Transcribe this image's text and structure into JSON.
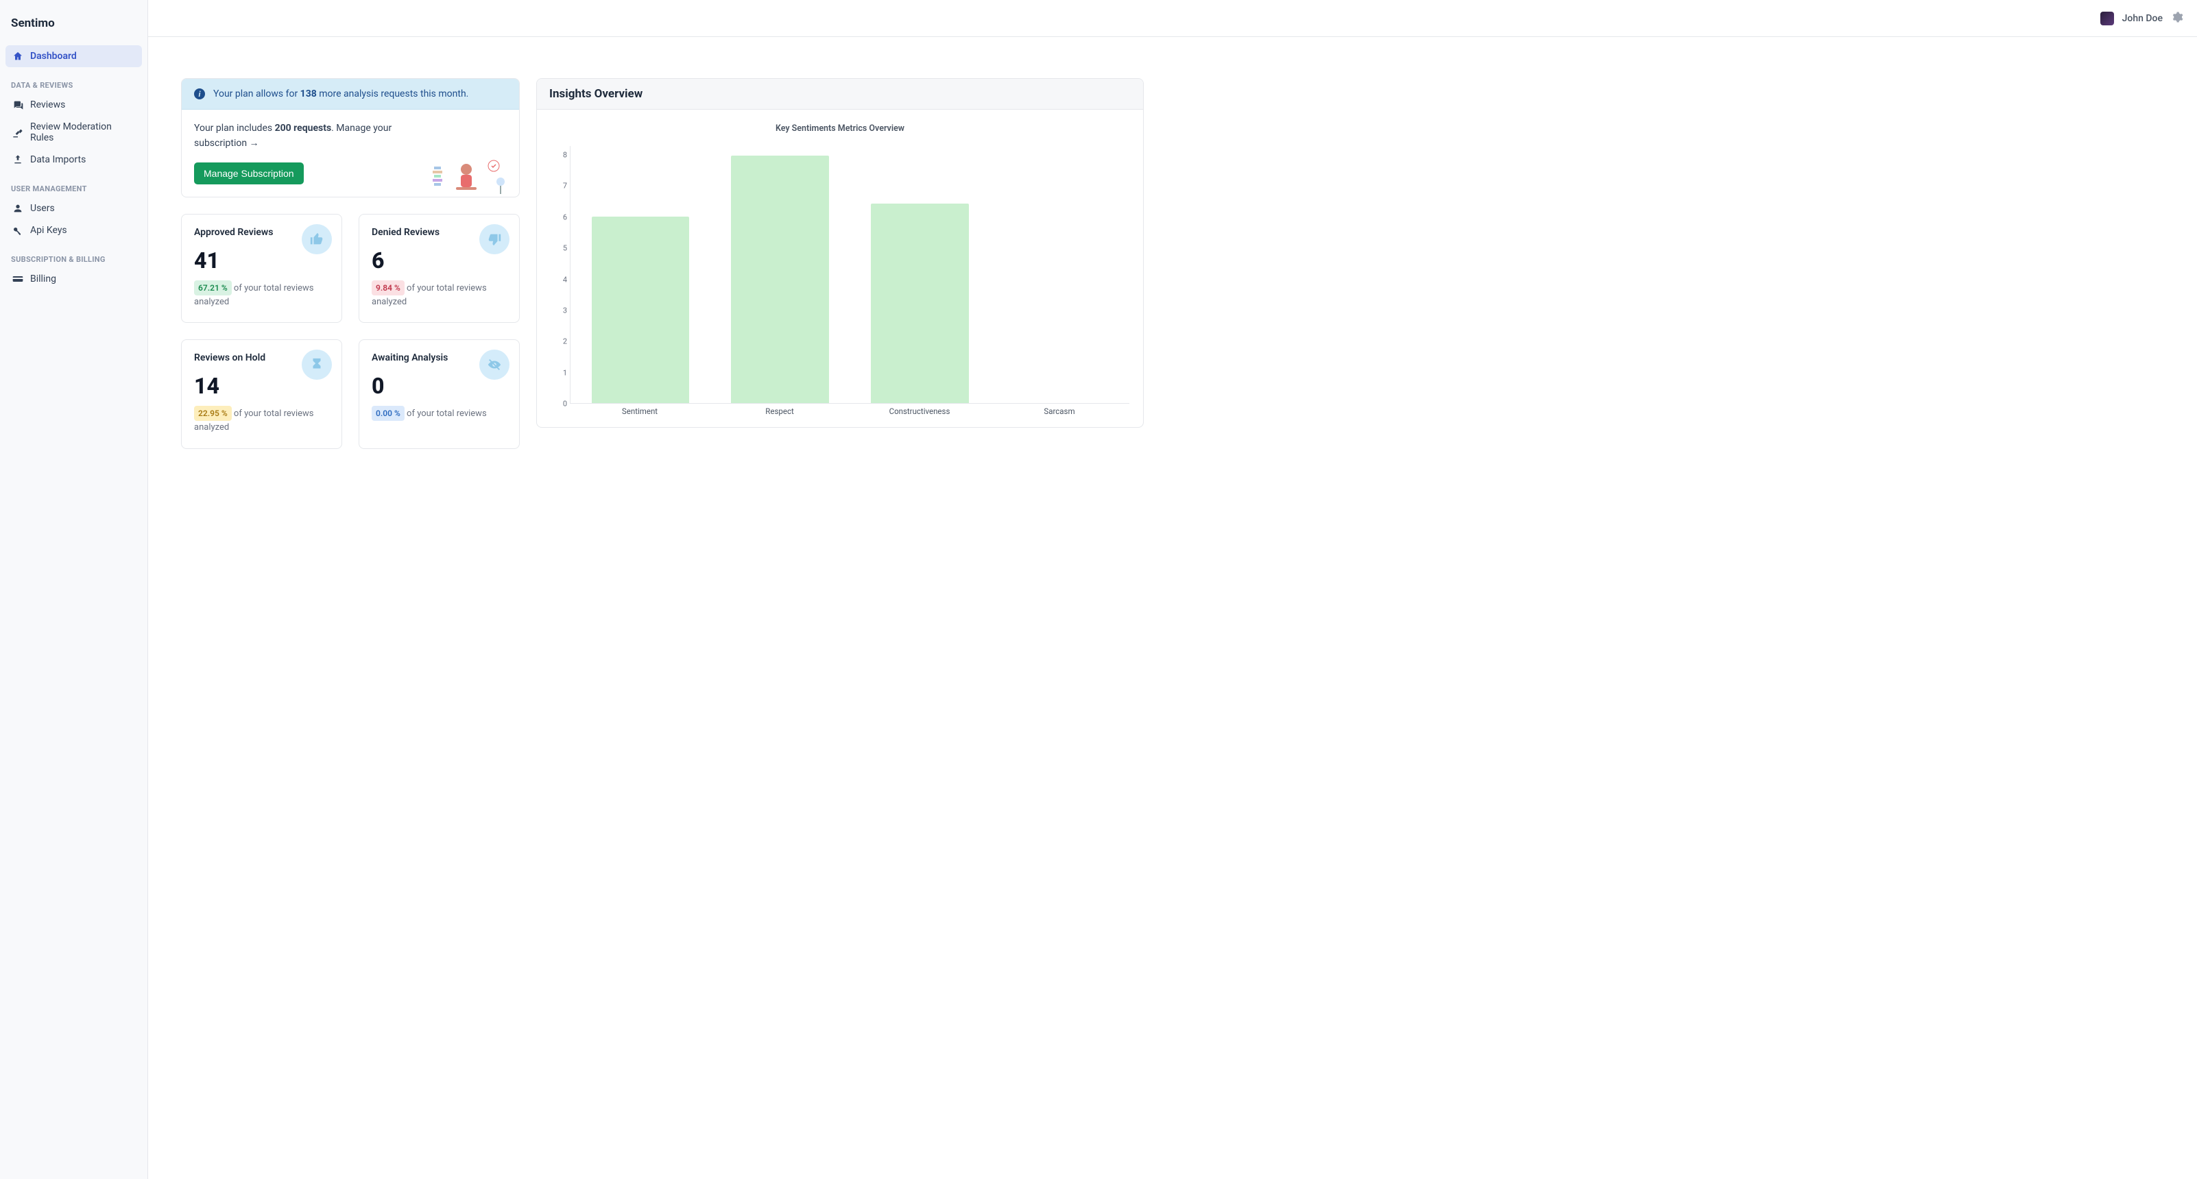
{
  "brand": "Sentimo",
  "user": {
    "name": "John Doe"
  },
  "sidebar": {
    "items": {
      "dashboard": "Dashboard",
      "reviews": "Reviews",
      "moderation": "Review Moderation Rules",
      "imports": "Data Imports",
      "users": "Users",
      "apikeys": "Api Keys",
      "billing": "Billing"
    },
    "headings": {
      "data": "DATA & REVIEWS",
      "usermgmt": "USER MANAGEMENT",
      "sub": "SUBSCRIPTION & BILLING"
    }
  },
  "plan": {
    "banner_pre": "Your plan allows for ",
    "banner_bold": "138",
    "banner_post": " more analysis requests this month.",
    "body_pre": "Your plan includes ",
    "body_bold": "200 requests",
    "body_post": ". Manage your subscription →",
    "button": "Manage Subscription"
  },
  "stats": {
    "approved": {
      "title": "Approved Reviews",
      "value": "41",
      "pct": "67.21 %",
      "caption": "of your total reviews analyzed"
    },
    "denied": {
      "title": "Denied Reviews",
      "value": "6",
      "pct": "9.84 %",
      "caption": "of your total reviews analyzed"
    },
    "hold": {
      "title": "Reviews on Hold",
      "value": "14",
      "pct": "22.95 %",
      "caption": "of your total reviews analyzed"
    },
    "awaiting": {
      "title": "Awaiting Analysis",
      "value": "0",
      "pct": "0.00 %",
      "caption": "of your total reviews"
    }
  },
  "insights": {
    "header": "Insights Overview",
    "chart_title": "Key Sentiments Metrics Overview"
  },
  "chart_data": {
    "type": "bar",
    "title": "Key Sentiments Metrics Overview",
    "xlabel": "",
    "ylabel": "",
    "ylim": [
      0,
      8
    ],
    "categories": [
      "Sentiment",
      "Respect",
      "Constructiveness",
      "Sarcasm"
    ],
    "values": [
      5.8,
      7.7,
      6.2,
      0
    ],
    "yticks": [
      0,
      1,
      2,
      3,
      4,
      5,
      6,
      7,
      8
    ]
  }
}
